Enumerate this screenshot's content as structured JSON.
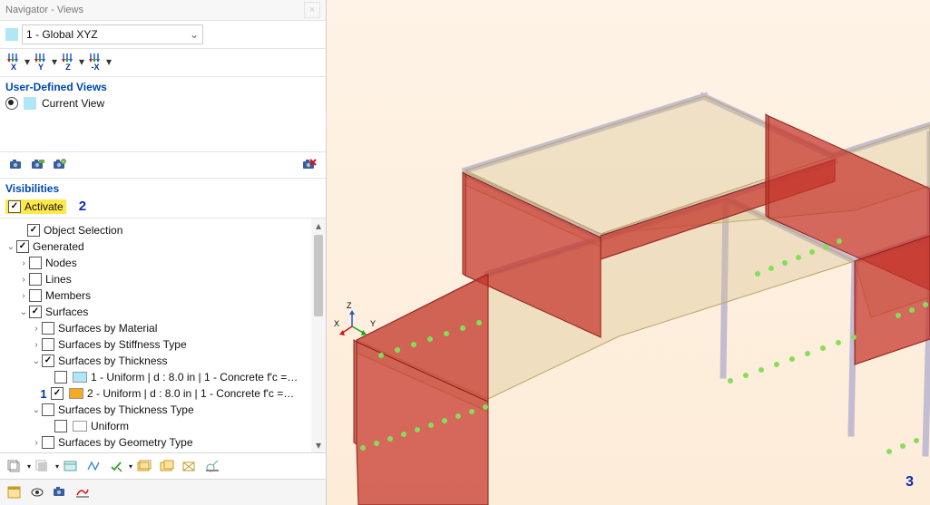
{
  "panel_title": "Navigator - Views",
  "axis_dropdown": {
    "value": "1 - Global XYZ"
  },
  "axis_buttons": [
    "X",
    "Y",
    "Z",
    "-X"
  ],
  "user_defined_views_label": "User-Defined Views",
  "current_view_label": "Current View",
  "visibilities_label": "Visibilities",
  "activate_label": "Activate",
  "annotation_1": "1",
  "annotation_2": "2",
  "annotation_3": "3",
  "tree": {
    "object_selection": "Object Selection",
    "generated": "Generated",
    "nodes": "Nodes",
    "lines": "Lines",
    "members": "Members",
    "surfaces": "Surfaces",
    "surf_by_material": "Surfaces by Material",
    "surf_by_stiff": "Surfaces by Stiffness Type",
    "surf_by_thick": "Surfaces by Thickness",
    "thick_1": "1 - Uniform | d : 8.0 in | 1 - Concrete f'c =…",
    "thick_2": "2 - Uniform | d : 8.0 in | 1 - Concrete f'c =…",
    "surf_by_thick_type": "Surfaces by Thickness Type",
    "uniform": "Uniform",
    "surf_by_geom": "Surfaces by Geometry Type"
  },
  "viewport_axis": {
    "z": "Z",
    "y": "Y",
    "x": "X"
  }
}
